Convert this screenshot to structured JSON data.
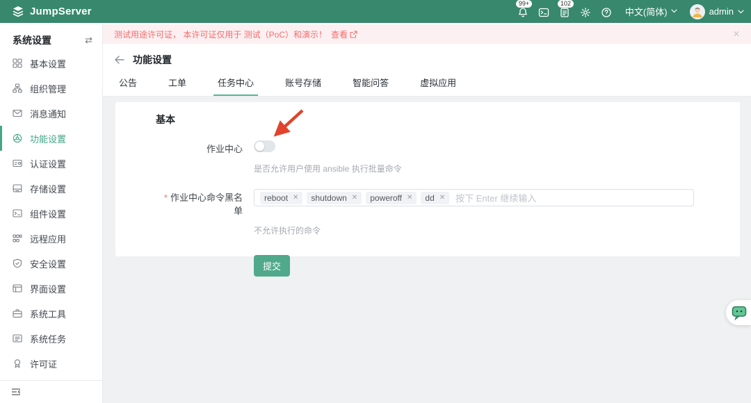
{
  "app": {
    "name": "JumpServer"
  },
  "topbar": {
    "bell_badge": "99+",
    "clipboard_badge": "102",
    "language": "中文(简体)",
    "username": "admin"
  },
  "license_banner": {
    "text": "测试用途许可证， 本许可证仅用于 测试（PoC）和演示！",
    "link_label": "查看",
    "close_icon": "✕"
  },
  "sidebar": {
    "title": "系统设置",
    "switch_icon": "⇄",
    "items": [
      {
        "label": "基本设置",
        "icon": "grid-icon",
        "active": false
      },
      {
        "label": "组织管理",
        "icon": "org-tree-icon",
        "active": false
      },
      {
        "label": "消息通知",
        "icon": "message-icon",
        "active": false
      },
      {
        "label": "功能设置",
        "icon": "feature-icon",
        "active": true
      },
      {
        "label": "认证设置",
        "icon": "id-card-icon",
        "active": false
      },
      {
        "label": "存储设置",
        "icon": "storage-icon",
        "active": false
      },
      {
        "label": "组件设置",
        "icon": "terminal-icon",
        "active": false
      },
      {
        "label": "远程应用",
        "icon": "remote-app-icon",
        "active": false
      },
      {
        "label": "安全设置",
        "icon": "shield-icon",
        "active": false
      },
      {
        "label": "界面设置",
        "icon": "layout-icon",
        "active": false
      },
      {
        "label": "系统工具",
        "icon": "toolbox-icon",
        "active": false
      },
      {
        "label": "系统任务",
        "icon": "task-icon",
        "active": false
      },
      {
        "label": "许可证",
        "icon": "license-icon",
        "active": false
      }
    ]
  },
  "page": {
    "title": "功能设置",
    "tabs": [
      {
        "label": "公告",
        "active": false
      },
      {
        "label": "工单",
        "active": false
      },
      {
        "label": "任务中心",
        "active": true
      },
      {
        "label": "账号存储",
        "active": false
      },
      {
        "label": "智能问答",
        "active": false
      },
      {
        "label": "虚拟应用",
        "active": false
      }
    ]
  },
  "form": {
    "section_title": "基本",
    "job_center": {
      "label": "作业中心",
      "enabled": false,
      "help": "是否允许用户使用 ansible 执行批量命令"
    },
    "blacklist": {
      "label": "作业中心命令黑名单",
      "required": true,
      "tags": [
        "reboot",
        "shutdown",
        "poweroff",
        "dd"
      ],
      "placeholder": "按下 Enter 继续输入",
      "help": "不允许执行的命令"
    },
    "submit_label": "提交"
  },
  "colors": {
    "header_green": "#37886c",
    "primary_green": "#45a586",
    "tab_underline_green": "#52b893",
    "button_green": "#4fa98a",
    "banner_bg": "#fdf0f2",
    "banner_text": "#f56c6c",
    "annotation_arrow_red": "#e0442d",
    "main_bg": "#f0f1f2"
  }
}
